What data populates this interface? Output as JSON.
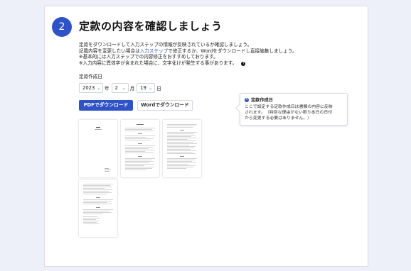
{
  "step": {
    "number": "2",
    "title": "定款の内容を確認しましょう"
  },
  "description": {
    "line1": "定款をダウンロードして入力ステップの情報が反映されているか確認しましょう。",
    "line2_pre": "記載内容を変更したい場合は",
    "line2_link": "入力ステップ",
    "line2_post": "で修正するか、Wordをダウンロードし直接編集しましょう。",
    "line3": "※基本的には入力ステップでの内容修正をおすすめしております。",
    "line4": "※入力内容に異体字が含まれた場合に、文字化けが発生する事があります。",
    "help_glyph": "?"
  },
  "date": {
    "label": "定款作成日",
    "year": "2023",
    "year_unit": "年",
    "month": "2",
    "month_unit": "月",
    "day": "19",
    "day_unit": "日"
  },
  "buttons": {
    "pdf": "PDFでダウンロード",
    "word": "Wordでダウンロード"
  },
  "tooltip": {
    "icon": "i",
    "title": "定款作成日",
    "body_line1": "ここで設定する定款作成日は書類の内容に反映",
    "body_line2": "されます。（特別な理由がない限り本日の日付",
    "body_line3": "から変更する必要はありません。）"
  },
  "preview": {
    "pages": [
      "page-1",
      "page-2",
      "page-3",
      "page-4"
    ]
  }
}
